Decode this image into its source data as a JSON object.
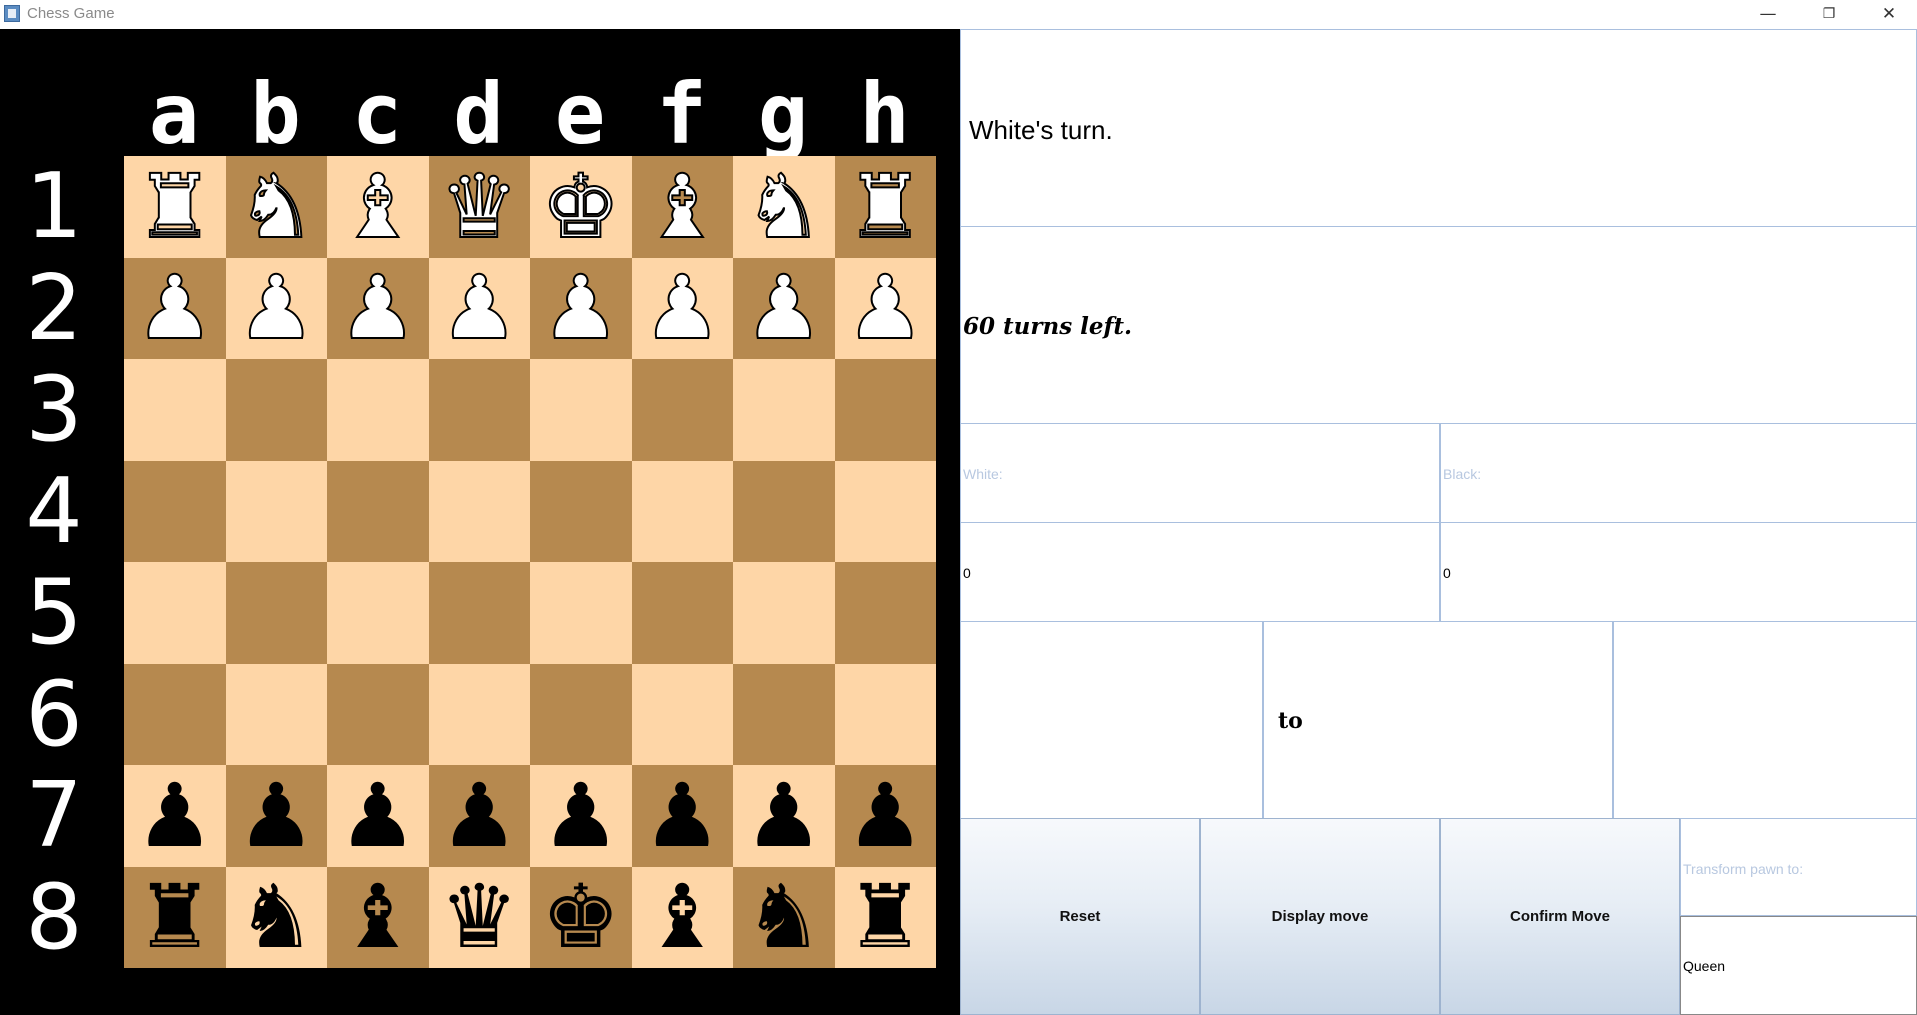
{
  "window": {
    "title": "Chess Game",
    "controls": {
      "minimize": "—",
      "maximize": "❐",
      "close": "✕"
    }
  },
  "board": {
    "files": [
      "a",
      "b",
      "c",
      "d",
      "e",
      "f",
      "g",
      "h"
    ],
    "ranks": [
      "1",
      "2",
      "3",
      "4",
      "5",
      "6",
      "7",
      "8"
    ],
    "colors": {
      "light": "#fed6a7",
      "dark": "#b6894f",
      "frame": "#000000"
    },
    "rows": [
      [
        "wR",
        "wN",
        "wB",
        "wQ",
        "wK",
        "wB",
        "wN",
        "wR"
      ],
      [
        "wP",
        "wP",
        "wP",
        "wP",
        "wP",
        "wP",
        "wP",
        "wP"
      ],
      [
        "",
        "",
        "",
        "",
        "",
        "",
        "",
        ""
      ],
      [
        "",
        "",
        "",
        "",
        "",
        "",
        "",
        ""
      ],
      [
        "",
        "",
        "",
        "",
        "",
        "",
        "",
        ""
      ],
      [
        "",
        "",
        "",
        "",
        "",
        "",
        "",
        ""
      ],
      [
        "bP",
        "bP",
        "bP",
        "bP",
        "bP",
        "bP",
        "bP",
        "bP"
      ],
      [
        "bR",
        "bN",
        "bB",
        "bQ",
        "bK",
        "bB",
        "bN",
        "bR"
      ]
    ]
  },
  "status": {
    "turn": "White's turn.",
    "turns_left": "60 turns left."
  },
  "score": {
    "white_label": "White:",
    "black_label": "Black:",
    "white_value": "0",
    "black_value": "0"
  },
  "move": {
    "from": "",
    "to_label": "to",
    "dest": ""
  },
  "buttons": {
    "reset": "Reset",
    "display": "Display move",
    "confirm": "Confirm Move"
  },
  "transform": {
    "label": "Transform pawn to:",
    "value": "Queen"
  }
}
